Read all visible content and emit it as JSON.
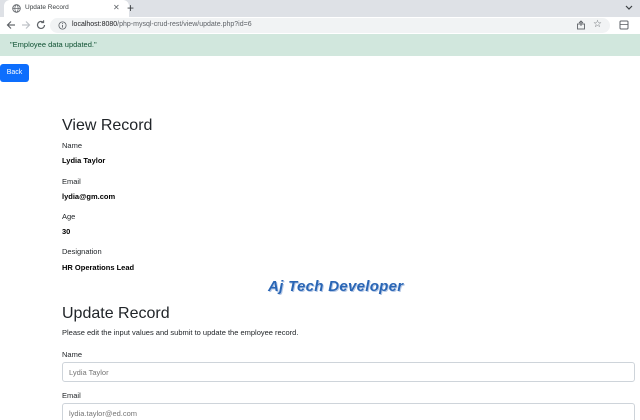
{
  "browser": {
    "tab_title": "Update Record",
    "url_host": "localhost:8080",
    "url_path": "/php-mysql-crud-rest/view/update.php?id=6",
    "icons": {
      "favicon": "globe-icon",
      "close": "close-icon",
      "new_tab": "plus-icon",
      "back": "arrow-left-icon",
      "forward": "arrow-right-icon",
      "reload": "reload-icon",
      "site_info": "info-icon",
      "share": "share-icon",
      "bookmark": "star-icon",
      "extension": "extension-icon",
      "tab_search": "chevron-down-icon"
    }
  },
  "alert": {
    "message": "\"Employee data updated.\"",
    "color_bg": "#d1e7dd",
    "color_text": "#0f5132"
  },
  "back_button": {
    "label": "Back",
    "color": "#0d6efd"
  },
  "view": {
    "title": "View Record",
    "fields": [
      {
        "label": "Name",
        "value": "Lydia Taylor"
      },
      {
        "label": "Email",
        "value": "lydia@gm.com"
      },
      {
        "label": "Age",
        "value": "30"
      },
      {
        "label": "Designation",
        "value": "HR Operations Lead"
      }
    ]
  },
  "watermark": {
    "text": "Aj Tech Developer",
    "color": "#2a66b5"
  },
  "update": {
    "title": "Update Record",
    "lead": "Please edit the input values and submit to update the employee record.",
    "name_label": "Name",
    "name_placeholder": "Lydia Taylor",
    "email_label": "Email",
    "email_placeholder": "lydia.taylor@ed.com"
  }
}
